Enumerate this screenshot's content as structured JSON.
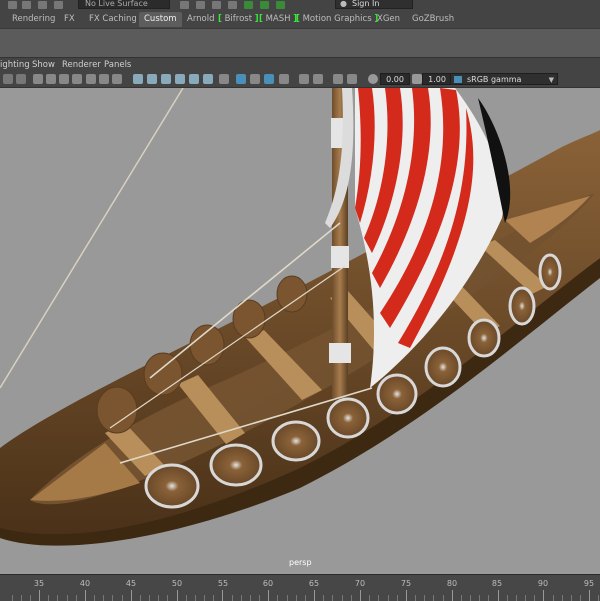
{
  "top_strip": {
    "live_surface": "No Live Surface",
    "sign_in": "Sign In"
  },
  "shelf_tabs": [
    {
      "label": "Rendering",
      "active": false,
      "bracket": false
    },
    {
      "label": "FX",
      "active": false,
      "bracket": false
    },
    {
      "label": "FX Caching",
      "active": false,
      "bracket": false
    },
    {
      "label": "Custom",
      "active": true,
      "bracket": false
    },
    {
      "label": "Arnold",
      "active": false,
      "bracket": false
    },
    {
      "label": "Bifrost",
      "active": false,
      "bracket": true
    },
    {
      "label": "MASH",
      "active": false,
      "bracket": true
    },
    {
      "label": "Motion Graphics",
      "active": false,
      "bracket": true
    },
    {
      "label": "XGen",
      "active": false,
      "bracket": false
    },
    {
      "label": "GoZBrush",
      "active": false,
      "bracket": false
    }
  ],
  "panel_menu": {
    "lighting": "ighting",
    "show": "Show",
    "renderer": "Renderer",
    "panels": "Panels"
  },
  "panel_toolbar": {
    "exposure": "0.00",
    "gamma": "1.00",
    "color_space": "sRGB gamma"
  },
  "viewport": {
    "camera_label": "persp"
  },
  "timeline": {
    "frame_labels": [
      "35",
      "40",
      "45",
      "50",
      "55",
      "60",
      "65",
      "70",
      "75",
      "80",
      "85",
      "90",
      "95"
    ]
  },
  "colors": {
    "active_icon": "#4a8fb8",
    "bracket_green": "#39e639",
    "viewport_bg": "#999999",
    "sail_red": "#d42a1c"
  },
  "icons": [
    "camera-icon",
    "grid-icon",
    "shaded-icon",
    "wireframe-icon",
    "lights-icon",
    "isolate-icon",
    "xray-icon",
    "exposure-icon",
    "gamma-icon",
    "color-space-icon"
  ]
}
